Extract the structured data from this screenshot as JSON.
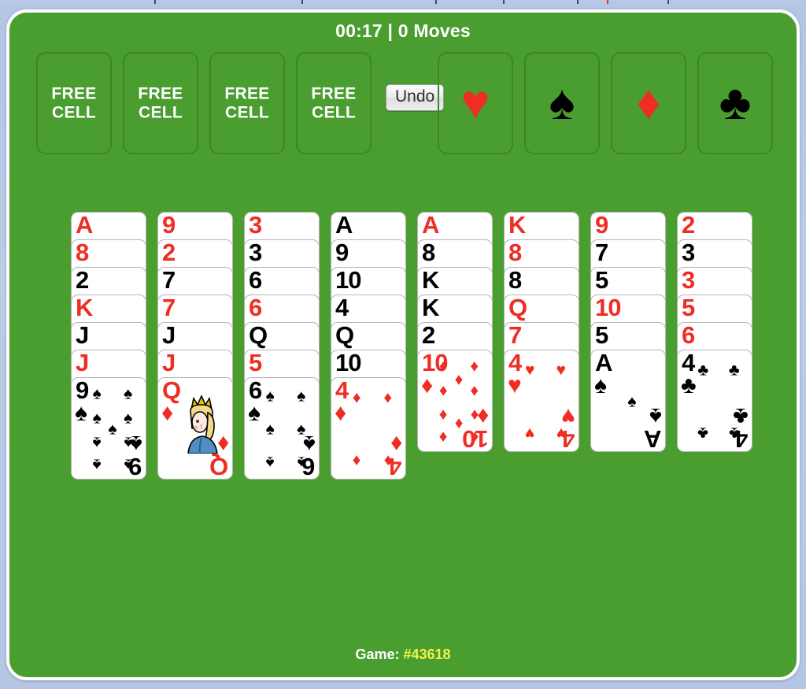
{
  "app": {
    "background_color": "#b9c9e6",
    "felt_color": "#4a9e2f",
    "red_suit_color": "#ee2d24",
    "black_suit_color": "#000000",
    "accent_color": "#f2f24a"
  },
  "status": {
    "text": "00:17 | 0 Moves",
    "time": "00:17",
    "moves": "0 Moves"
  },
  "toolbar": {
    "undo_label": "Undo"
  },
  "free_cells": [
    {
      "label": "FREE\nCELL",
      "line1": "FREE",
      "line2": "CELL",
      "occupied": false
    },
    {
      "label": "FREE\nCELL",
      "line1": "FREE",
      "line2": "CELL",
      "occupied": false
    },
    {
      "label": "FREE\nCELL",
      "line1": "FREE",
      "line2": "CELL",
      "occupied": false
    },
    {
      "label": "FREE\nCELL",
      "line1": "FREE",
      "line2": "CELL",
      "occupied": false
    }
  ],
  "foundations": [
    {
      "suit": "hearts",
      "glyph": "♥",
      "color": "red",
      "empty": true
    },
    {
      "suit": "spades",
      "glyph": "♠",
      "color": "black",
      "empty": true
    },
    {
      "suit": "diamonds",
      "glyph": "♦",
      "color": "red",
      "empty": true
    },
    {
      "suit": "clubs",
      "glyph": "♣",
      "color": "black",
      "empty": true
    }
  ],
  "tableau": [
    {
      "index": 1,
      "cards": [
        {
          "rank": "A",
          "suit": "diamonds",
          "glyph": "♦",
          "color": "red"
        },
        {
          "rank": "8",
          "suit": "diamonds",
          "glyph": "♦",
          "color": "red"
        },
        {
          "rank": "2",
          "suit": "spades",
          "glyph": "♠",
          "color": "black"
        },
        {
          "rank": "K",
          "suit": "hearts",
          "glyph": "♥",
          "color": "red"
        },
        {
          "rank": "J",
          "suit": "clubs",
          "glyph": "♣",
          "color": "black"
        },
        {
          "rank": "J",
          "suit": "hearts",
          "glyph": "♥",
          "color": "red"
        },
        {
          "rank": "9",
          "suit": "spades",
          "glyph": "♠",
          "color": "black"
        }
      ]
    },
    {
      "index": 2,
      "cards": [
        {
          "rank": "9",
          "suit": "diamonds",
          "glyph": "♦",
          "color": "red"
        },
        {
          "rank": "2",
          "suit": "hearts",
          "glyph": "♥",
          "color": "red"
        },
        {
          "rank": "7",
          "suit": "clubs",
          "glyph": "♣",
          "color": "black"
        },
        {
          "rank": "7",
          "suit": "diamonds",
          "glyph": "♦",
          "color": "red"
        },
        {
          "rank": "J",
          "suit": "spades",
          "glyph": "♠",
          "color": "black"
        },
        {
          "rank": "J",
          "suit": "diamonds",
          "glyph": "♦",
          "color": "red"
        },
        {
          "rank": "Q",
          "suit": "diamonds",
          "glyph": "♦",
          "color": "red",
          "court": true
        }
      ]
    },
    {
      "index": 3,
      "cards": [
        {
          "rank": "3",
          "suit": "diamonds",
          "glyph": "♦",
          "color": "red"
        },
        {
          "rank": "3",
          "suit": "clubs",
          "glyph": "♣",
          "color": "black"
        },
        {
          "rank": "6",
          "suit": "clubs",
          "glyph": "♣",
          "color": "black"
        },
        {
          "rank": "6",
          "suit": "diamonds",
          "glyph": "♦",
          "color": "red"
        },
        {
          "rank": "Q",
          "suit": "clubs",
          "glyph": "♣",
          "color": "black"
        },
        {
          "rank": "5",
          "suit": "hearts",
          "glyph": "♥",
          "color": "red"
        },
        {
          "rank": "6",
          "suit": "spades",
          "glyph": "♠",
          "color": "black"
        }
      ]
    },
    {
      "index": 4,
      "cards": [
        {
          "rank": "A",
          "suit": "clubs",
          "glyph": "♣",
          "color": "black"
        },
        {
          "rank": "9",
          "suit": "clubs",
          "glyph": "♣",
          "color": "black"
        },
        {
          "rank": "10",
          "suit": "spades",
          "glyph": "♠",
          "color": "black"
        },
        {
          "rank": "4",
          "suit": "spades",
          "glyph": "♠",
          "color": "black"
        },
        {
          "rank": "Q",
          "suit": "spades",
          "glyph": "♠",
          "color": "black"
        },
        {
          "rank": "10",
          "suit": "clubs",
          "glyph": "♣",
          "color": "black"
        },
        {
          "rank": "4",
          "suit": "diamonds",
          "glyph": "♦",
          "color": "red"
        }
      ]
    },
    {
      "index": 5,
      "cards": [
        {
          "rank": "A",
          "suit": "hearts",
          "glyph": "♥",
          "color": "red"
        },
        {
          "rank": "8",
          "suit": "spades",
          "glyph": "♠",
          "color": "black"
        },
        {
          "rank": "K",
          "suit": "spades",
          "glyph": "♠",
          "color": "black"
        },
        {
          "rank": "K",
          "suit": "clubs",
          "glyph": "♣",
          "color": "black"
        },
        {
          "rank": "2",
          "suit": "clubs",
          "glyph": "♣",
          "color": "black"
        },
        {
          "rank": "10",
          "suit": "diamonds",
          "glyph": "♦",
          "color": "red"
        }
      ]
    },
    {
      "index": 6,
      "cards": [
        {
          "rank": "K",
          "suit": "diamonds",
          "glyph": "♦",
          "color": "red"
        },
        {
          "rank": "8",
          "suit": "hearts",
          "glyph": "♥",
          "color": "red"
        },
        {
          "rank": "8",
          "suit": "clubs",
          "glyph": "♣",
          "color": "black"
        },
        {
          "rank": "Q",
          "suit": "hearts",
          "glyph": "♥",
          "color": "red"
        },
        {
          "rank": "7",
          "suit": "hearts",
          "glyph": "♥",
          "color": "red"
        },
        {
          "rank": "4",
          "suit": "hearts",
          "glyph": "♥",
          "color": "red"
        }
      ]
    },
    {
      "index": 7,
      "cards": [
        {
          "rank": "9",
          "suit": "hearts",
          "glyph": "♥",
          "color": "red"
        },
        {
          "rank": "7",
          "suit": "spades",
          "glyph": "♠",
          "color": "black"
        },
        {
          "rank": "5",
          "suit": "spades",
          "glyph": "♠",
          "color": "black"
        },
        {
          "rank": "10",
          "suit": "hearts",
          "glyph": "♥",
          "color": "red"
        },
        {
          "rank": "5",
          "suit": "clubs",
          "glyph": "♣",
          "color": "black"
        },
        {
          "rank": "A",
          "suit": "spades",
          "glyph": "♠",
          "color": "black"
        }
      ]
    },
    {
      "index": 8,
      "cards": [
        {
          "rank": "2",
          "suit": "diamonds",
          "glyph": "♦",
          "color": "red"
        },
        {
          "rank": "3",
          "suit": "spades",
          "glyph": "♠",
          "color": "black"
        },
        {
          "rank": "3",
          "suit": "hearts",
          "glyph": "♥",
          "color": "red"
        },
        {
          "rank": "5",
          "suit": "diamonds",
          "glyph": "♦",
          "color": "red"
        },
        {
          "rank": "6",
          "suit": "hearts",
          "glyph": "♥",
          "color": "red"
        },
        {
          "rank": "4",
          "suit": "clubs",
          "glyph": "♣",
          "color": "black"
        }
      ]
    }
  ],
  "footer": {
    "game_label": "Game: ",
    "game_number": "#43618"
  }
}
